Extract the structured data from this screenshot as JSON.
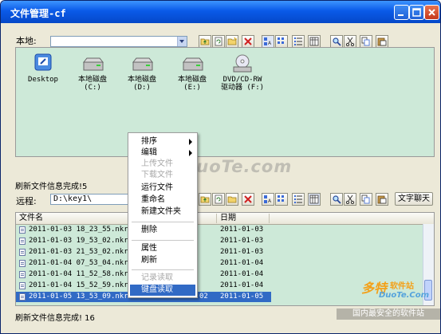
{
  "window": {
    "title": "文件管理-cf"
  },
  "local": {
    "label": "本地:",
    "path": "",
    "items": [
      {
        "name": "Desktop",
        "sub": ""
      },
      {
        "name": "本地磁盘",
        "sub": "(C:)"
      },
      {
        "name": "本地磁盘",
        "sub": "(D:)"
      },
      {
        "name": "本地磁盘",
        "sub": "(E:)"
      },
      {
        "name": "DVD/CD-RW",
        "sub": "驱动器 (F:)"
      }
    ]
  },
  "status_local": "刷新文件信息完成!5",
  "remote": {
    "label": "远程:",
    "path": "D:\\key1\\",
    "chat_button": "文字聊天",
    "columns": [
      "文件名",
      "日期"
    ],
    "rows": [
      {
        "name": "2011-01-03 18_23_55.nkr",
        "date": "2011-01-03"
      },
      {
        "name": "2011-01-03 19_53_02.nkr",
        "date": "2011-01-03"
      },
      {
        "name": "2011-01-03 21_53_02.nkr",
        "date": "2011-01-03"
      },
      {
        "name": "2011-01-04 07_53_04.nkr",
        "date": "2011-01-04"
      },
      {
        "name": "2011-01-04 11_52_58.nkr",
        "date": "2011-01-04"
      },
      {
        "name": "2011-01-04 15_52_59.nkr",
        "date": "2011-01-04"
      },
      {
        "name": "2011-01-05 13_53_09.nkr",
        "date": "2011-01-05",
        "extra": "02",
        "selected": true
      }
    ]
  },
  "status_remote": "刷新文件信息完成! 16",
  "context_menu": {
    "items": [
      {
        "label": "排序",
        "submenu": true
      },
      {
        "label": "编辑",
        "submenu": true
      },
      {
        "label": "上传文件",
        "disabled": true
      },
      {
        "label": "下载文件",
        "disabled": true
      },
      {
        "label": "运行文件"
      },
      {
        "label": "重命名"
      },
      {
        "label": "新建文件夹"
      },
      {
        "label": "删除"
      },
      {
        "label": "属性"
      },
      {
        "label": "刷新"
      },
      {
        "label": "记录读取",
        "disabled": true
      },
      {
        "label": "键盘读取",
        "selected": true
      }
    ]
  },
  "watermarks": {
    "main": "www.DuoTe.com",
    "brand": "多特",
    "brand_suffix": "软件站",
    "site": "DuoTe.Com",
    "slogan": "国内最安全的软件站"
  },
  "colors": {
    "panel_bg": "#cde9d8",
    "title_bar": "#0a5ae8",
    "selection": "#316ac5"
  }
}
